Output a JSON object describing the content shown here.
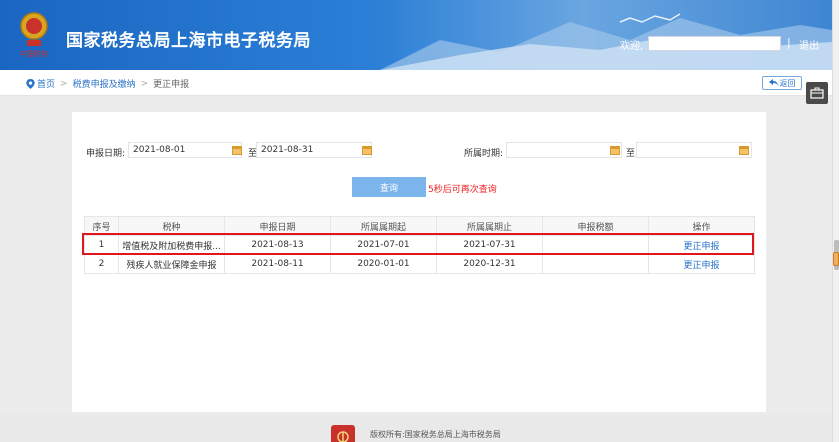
{
  "header": {
    "title": "国家税务总局上海市电子税务局",
    "welcome": "欢迎,",
    "separator": "|",
    "logout": "退出"
  },
  "breadcrumb": {
    "home": "首页",
    "level1": "税费申报及缴纳",
    "current": "更正申报",
    "arrow": ">"
  },
  "back_button": "返回",
  "filters": {
    "date_label": "申报日期:",
    "date_from": "2021-08-01",
    "to_label": "至",
    "date_to": "2021-08-31",
    "period_label": "所属时期:",
    "period_from": "",
    "period_to": ""
  },
  "query": {
    "button": "查询",
    "hint": "5秒后可再次查询"
  },
  "table": {
    "headers": [
      "序号",
      "税种",
      "申报日期",
      "所属属期起",
      "所属属期止",
      "申报税额",
      "操作"
    ],
    "rows": [
      {
        "index": "1",
        "tax": "增值税及附加税费申报...",
        "date": "2021-08-13",
        "start": "2021-07-01",
        "end": "2021-07-31",
        "amount": "",
        "action": "更正申报"
      },
      {
        "index": "2",
        "tax": "残疾人就业保障金申报",
        "date": "2021-08-11",
        "start": "2020-01-01",
        "end": "2020-12-31",
        "amount": "",
        "action": "更正申报"
      }
    ]
  },
  "footer": {
    "copyright": "版权所有:国家税务总局上海市税务局"
  },
  "colors": {
    "header_blue": "#1a66c2",
    "link_blue": "#2a72c8",
    "query_button": "#7cb5ec",
    "highlight_red": "#e0161b",
    "hint_red": "#ee2222"
  }
}
